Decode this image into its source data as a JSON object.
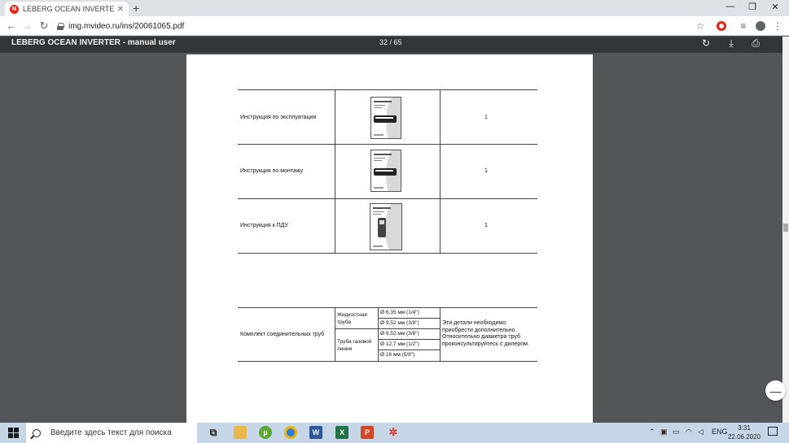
{
  "browser": {
    "tab_title": "LEBERG OCEAN INVERTER - man",
    "tab_favicon": "mvideo-favicon",
    "new_tab_label": "+",
    "url": "img.mvideo.ru/ins/20061065.pdf"
  },
  "pdf": {
    "title": "LEBERG OCEAN INVERTER - manual user",
    "page_indicator": "32 / 65"
  },
  "document": {
    "rows": [
      {
        "name": "Инструкция по эксплуатации",
        "icon": "manual-booklet-icon",
        "qty": "1"
      },
      {
        "name": "Инструкция по монтажу",
        "icon": "installation-booklet-icon",
        "qty": "1"
      },
      {
        "name": "Инструкция к ПДУ",
        "icon": "remote-booklet-icon",
        "qty": "1"
      }
    ],
    "pipes": {
      "label": "Комплект соединительных труб",
      "liquid_label": "Жидкостная труба",
      "gas_label": "Труба газовой линии",
      "sizes": [
        "Ø 6,35 мм (1/4\")",
        "Ø 9,52 мм (3/8\")",
        "Ø 9,52 мм (3/8\")",
        "Ø 12,7 мм (1/2\")",
        "Ø 16 мм (5/8\")"
      ],
      "note": "Эти детали необходимо приобрести дополнительно. Относительно диаметра труб проконсультируйтесь с дилером."
    }
  },
  "zoom_out_label": "—",
  "taskbar": {
    "search_placeholder": "Введите здесь текст для поиска",
    "language": "ENG",
    "time": "3:31",
    "date": "22.06.2020"
  }
}
